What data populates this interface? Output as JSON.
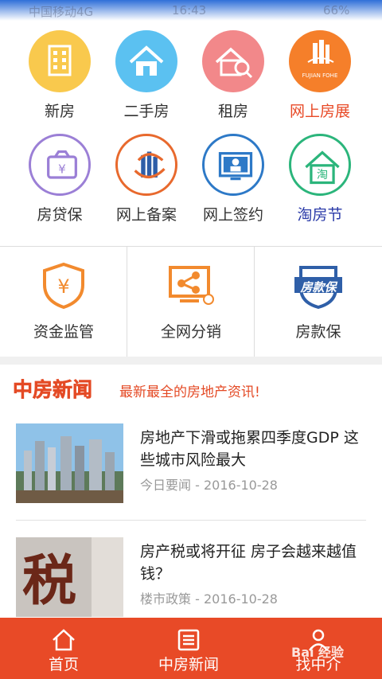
{
  "status_bar": {
    "carrier": "中国移动4G",
    "time": "16:43",
    "battery": "66%"
  },
  "top_icons": [
    {
      "label": "新房",
      "icon": "building-icon",
      "color": "#f9c94d"
    },
    {
      "label": "二手房",
      "icon": "house-icon",
      "color": "#5bc1f1"
    },
    {
      "label": "租房",
      "icon": "rent-key-icon",
      "color": "#f2888a"
    },
    {
      "label": "网上房展",
      "icon": "fujian-fohe-logo",
      "color": "#f57f2a",
      "brand_text": "FUJIAN FOHE"
    },
    {
      "label": "房贷保",
      "icon": "wallet-yuan-icon",
      "color": "#9b7fd6"
    },
    {
      "label": "网上备案",
      "icon": "record-logo-icon",
      "color": "#e8692d"
    },
    {
      "label": "网上签约",
      "icon": "monitor-person-icon",
      "color": "#2d79c7"
    },
    {
      "label": "淘房节",
      "icon": "tao-house-icon",
      "color": "#2bb57b"
    }
  ],
  "services": [
    {
      "label": "资金监管",
      "icon": "shield-yuan-icon",
      "color": "#f28a2e"
    },
    {
      "label": "全网分销",
      "icon": "share-screen-icon",
      "color": "#f28a2e"
    },
    {
      "label": "房款保",
      "icon": "fangkuanbao-badge-icon",
      "color": "#2f5fa8",
      "badge_text": "房款保"
    }
  ],
  "news_section": {
    "logo_text": "中房新闻",
    "tagline": "最新最全的房地产资讯!"
  },
  "news": [
    {
      "title": "房地产下滑或拖累四季度GDP 这些城市风险最大",
      "category": "今日要闻",
      "date": "2016-10-28"
    },
    {
      "title": "房产税或将开征 房子会越来越值钱？",
      "category": "楼市政策",
      "date": "2016-10-28",
      "thumb_text": "税"
    }
  ],
  "bottom_nav": [
    {
      "label": "首页",
      "icon": "home-icon"
    },
    {
      "label": "中房新闻",
      "icon": "news-list-icon"
    },
    {
      "label": "找中介",
      "icon": "agent-icon"
    }
  ],
  "watermark": "Bai 经验",
  "accent_color": "#e84a27"
}
